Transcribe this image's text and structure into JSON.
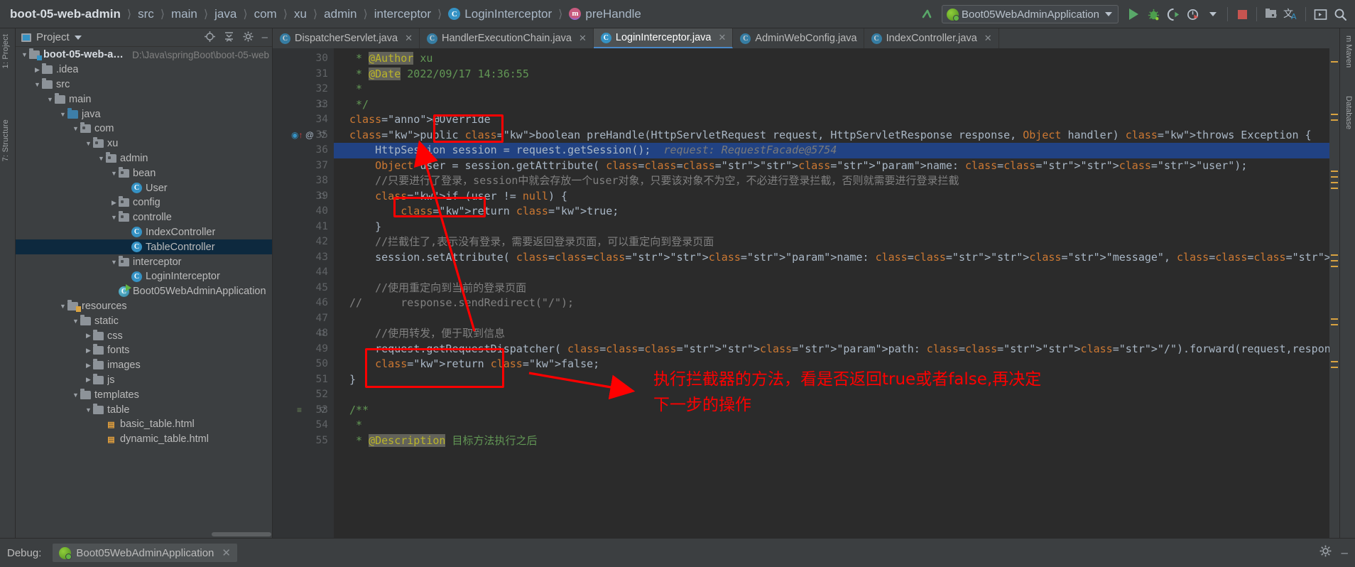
{
  "breadcrumb": {
    "items": [
      {
        "label": "boot-05-web-admin",
        "icon": null
      },
      {
        "label": "src",
        "icon": null
      },
      {
        "label": "main",
        "icon": null
      },
      {
        "label": "java",
        "icon": null
      },
      {
        "label": "com",
        "icon": null
      },
      {
        "label": "xu",
        "icon": null
      },
      {
        "label": "admin",
        "icon": null
      },
      {
        "label": "interceptor",
        "icon": null
      },
      {
        "label": "LoginInterceptor",
        "icon": "class-icon"
      },
      {
        "label": "preHandle",
        "icon": "method-icon"
      }
    ]
  },
  "toolbar": {
    "back_arrow": "back-arrow-icon",
    "run_config": "Boot05WebAdminApplication",
    "buttons": [
      {
        "name": "run-button",
        "glyph": "play"
      },
      {
        "name": "debug-button",
        "glyph": "bug"
      },
      {
        "name": "run-with-coverage-button",
        "glyph": "coverage"
      },
      {
        "name": "profiler-button",
        "glyph": "profiler"
      },
      {
        "name": "stop-button",
        "glyph": "stop"
      },
      {
        "name": "project-structure-button",
        "glyph": "structure"
      },
      {
        "name": "translate-button",
        "glyph": "translate"
      },
      {
        "name": "terminal-button",
        "glyph": "terminal"
      },
      {
        "name": "search-everywhere-button",
        "glyph": "search"
      }
    ]
  },
  "left_strip": {
    "tabs": [
      "1: Project",
      "7: Structure"
    ]
  },
  "right_strip": {
    "tabs": [
      "m Maven",
      "Database"
    ]
  },
  "sidebar": {
    "title": "Project",
    "actions": [
      "locate-icon",
      "collapse-all-icon",
      "settings-icon",
      "hide-icon"
    ],
    "tree": [
      {
        "depth": 0,
        "arrow": "down",
        "icon": "module-folder",
        "label": "boot-05-web-admin",
        "hint": "D:\\Java\\springBoot\\boot-05-web",
        "root": true
      },
      {
        "depth": 1,
        "arrow": "right",
        "icon": "folder",
        "label": ".idea"
      },
      {
        "depth": 1,
        "arrow": "down",
        "icon": "folder",
        "label": "src"
      },
      {
        "depth": 2,
        "arrow": "down",
        "icon": "folder",
        "label": "main"
      },
      {
        "depth": 3,
        "arrow": "down",
        "icon": "source-folder",
        "label": "java"
      },
      {
        "depth": 4,
        "arrow": "down",
        "icon": "package",
        "label": "com"
      },
      {
        "depth": 5,
        "arrow": "down",
        "icon": "package",
        "label": "xu"
      },
      {
        "depth": 6,
        "arrow": "down",
        "icon": "package",
        "label": "admin"
      },
      {
        "depth": 7,
        "arrow": "down",
        "icon": "package",
        "label": "bean"
      },
      {
        "depth": 8,
        "arrow": "none",
        "icon": "class",
        "label": "User"
      },
      {
        "depth": 7,
        "arrow": "right",
        "icon": "package",
        "label": "config"
      },
      {
        "depth": 7,
        "arrow": "down",
        "icon": "package",
        "label": "controlle"
      },
      {
        "depth": 8,
        "arrow": "none",
        "icon": "class",
        "label": "IndexController"
      },
      {
        "depth": 8,
        "arrow": "none",
        "icon": "class",
        "label": "TableController",
        "selected": true
      },
      {
        "depth": 7,
        "arrow": "down",
        "icon": "package",
        "label": "interceptor"
      },
      {
        "depth": 8,
        "arrow": "none",
        "icon": "class",
        "label": "LoginInterceptor"
      },
      {
        "depth": 7,
        "arrow": "none",
        "icon": "spring-class",
        "label": "Boot05WebAdminApplication"
      },
      {
        "depth": 3,
        "arrow": "down",
        "icon": "resource-folder",
        "label": "resources"
      },
      {
        "depth": 4,
        "arrow": "down",
        "icon": "folder",
        "label": "static"
      },
      {
        "depth": 5,
        "arrow": "right",
        "icon": "folder",
        "label": "css"
      },
      {
        "depth": 5,
        "arrow": "right",
        "icon": "folder",
        "label": "fonts"
      },
      {
        "depth": 5,
        "arrow": "right",
        "icon": "folder",
        "label": "images"
      },
      {
        "depth": 5,
        "arrow": "right",
        "icon": "folder",
        "label": "js"
      },
      {
        "depth": 4,
        "arrow": "down",
        "icon": "folder",
        "label": "templates"
      },
      {
        "depth": 5,
        "arrow": "down",
        "icon": "folder",
        "label": "table"
      },
      {
        "depth": 6,
        "arrow": "none",
        "icon": "html",
        "label": "basic_table.html"
      },
      {
        "depth": 6,
        "arrow": "none",
        "icon": "html",
        "label": "dynamic_table.html"
      }
    ]
  },
  "editor": {
    "tabs": [
      {
        "label": "DispatcherServlet.java",
        "icon": "class-icon",
        "active": false,
        "closable": true
      },
      {
        "label": "HandlerExecutionChain.java",
        "icon": "class-icon",
        "active": false,
        "closable": true
      },
      {
        "label": "LoginInterceptor.java",
        "icon": "class-icon",
        "active": true,
        "closable": true
      },
      {
        "label": "AdminWebConfig.java",
        "icon": "class-icon",
        "active": false,
        "closable": false
      },
      {
        "label": "IndexController.java",
        "icon": "class-icon",
        "active": false,
        "closable": true
      }
    ],
    "first_line_number": 30,
    "highlighted_line": 36,
    "lines": [
      {
        "n": 30,
        "text": " * @Author xu"
      },
      {
        "n": 31,
        "text": " * @Date 2022/09/17 14:36:55"
      },
      {
        "n": 32,
        "text": " *"
      },
      {
        "n": 33,
        "text": " */"
      },
      {
        "n": 34,
        "text": "@Override"
      },
      {
        "n": 35,
        "text": "public boolean preHandle(HttpServletRequest request, HttpServletResponse response, Object handler) throws Exception {   request:"
      },
      {
        "n": 36,
        "text": "    HttpSession session = request.getSession();  request: RequestFacade@5754"
      },
      {
        "n": 37,
        "text": "    Object user = session.getAttribute( name: \"user\");"
      },
      {
        "n": 38,
        "text": "    //只要进行了登录，session中就会存放一个user对象，只要该对象不为空，不必进行登录拦截，否则就需要进行登录拦截"
      },
      {
        "n": 39,
        "text": "    if (user != null) {"
      },
      {
        "n": 40,
        "text": "        return true;"
      },
      {
        "n": 41,
        "text": "    }"
      },
      {
        "n": 42,
        "text": "    //拦截住了,表示没有登录，需要返回登录页面，可以重定向到登录页面"
      },
      {
        "n": 43,
        "text": "    session.setAttribute( name: \"message\", value: \"请先登录\");"
      },
      {
        "n": 44,
        "text": ""
      },
      {
        "n": 45,
        "text": "    //使用重定向到当前的登录页面"
      },
      {
        "n": 46,
        "text": "//      response.sendRedirect(\"/\");"
      },
      {
        "n": 47,
        "text": ""
      },
      {
        "n": 48,
        "text": "    //使用转发，便于取到信息"
      },
      {
        "n": 49,
        "text": "    request.getRequestDispatcher( path: \"/\").forward(request,response);"
      },
      {
        "n": 50,
        "text": "    return false;"
      },
      {
        "n": 51,
        "text": "}"
      },
      {
        "n": 52,
        "text": ""
      },
      {
        "n": 53,
        "text": "/**"
      },
      {
        "n": 54,
        "text": " *"
      },
      {
        "n": 55,
        "text": " * @Description 目标方法执行之后"
      }
    ]
  },
  "annotations": {
    "note": "执行拦截器的方法，看是否返回true或者false,再决定\n下一步的操作",
    "boxes": [
      "preHandle",
      "return true;",
      "return false;"
    ],
    "color": "#ff0000"
  },
  "status_bar": {
    "debug_label": "Debug:",
    "session": "Boot05WebAdminApplication",
    "close": "close-icon",
    "settings": "settings-icon",
    "minimize": "minimize-icon"
  }
}
